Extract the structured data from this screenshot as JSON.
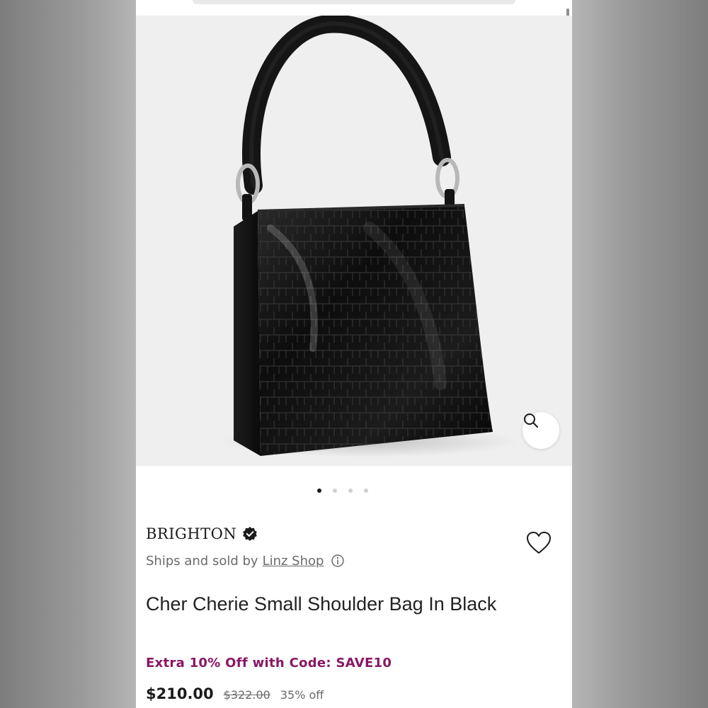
{
  "product": {
    "brand": "BRIGHTON",
    "seller_prefix": "Ships and sold by",
    "seller_name": "Linz Shop",
    "title": "Cher Cherie Small Shoulder Bag In Black",
    "promo": "Extra 10% Off with Code: SAVE10",
    "price": "$210.00",
    "original_price": "$322.00",
    "discount": "35% off"
  },
  "gallery": {
    "image_count": 4,
    "active_index": 0
  },
  "icons": {
    "zoom": "magnifier-icon",
    "verified": "verified-badge-icon",
    "info": "info-icon",
    "favorite": "heart-icon"
  },
  "colors": {
    "promo": "#8a1764",
    "page_bg": "#ffffff",
    "image_bg": "#efefef"
  }
}
